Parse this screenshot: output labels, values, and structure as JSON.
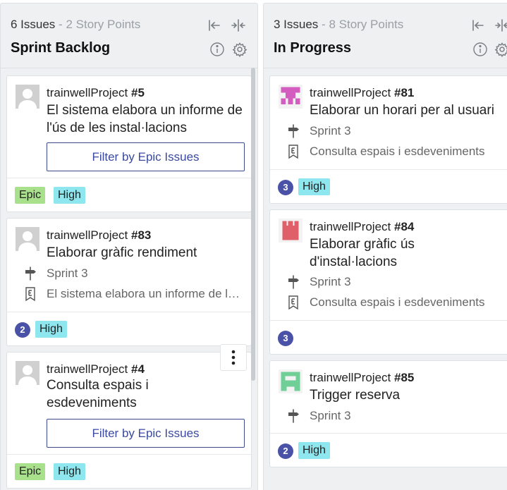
{
  "columns": [
    {
      "issues": "6 Issues",
      "separator": "-",
      "story_points": "2 Story Points",
      "title": "Sprint Backlog",
      "cards": [
        {
          "project": "trainwellProject",
          "number": "#5",
          "title": "El sistema elabora un informe de l'ús de les instal·lacions",
          "filter_label": "Filter by Epic Issues",
          "tags": [
            "Epic",
            "High"
          ],
          "avatar": "placeholder-avatar"
        },
        {
          "project": "trainwellProject",
          "number": "#83",
          "title": "Elaborar gràfic rendiment",
          "sprint": "Sprint 3",
          "epic": "El sistema elabora un informe de l'ús de les instal·lacions",
          "points": "2",
          "tags": [
            "High"
          ],
          "avatar": "placeholder-avatar"
        },
        {
          "project": "trainwellProject",
          "number": "#4",
          "title": "Consulta espais i esdeveniments",
          "filter_label": "Filter by Epic Issues",
          "tags": [
            "Epic",
            "High"
          ],
          "avatar": "placeholder-avatar"
        }
      ]
    },
    {
      "issues": "3 Issues",
      "separator": "-",
      "story_points": "8 Story Points",
      "title": "In Progress",
      "cards": [
        {
          "project": "trainwellProject",
          "number": "#81",
          "title": "Elaborar un horari per al usuari",
          "sprint": "Sprint 3",
          "epic": "Consulta espais i esdeveniments",
          "points": "3",
          "tags": [
            "High"
          ],
          "avatar": "identicon-pink"
        },
        {
          "project": "trainwellProject",
          "number": "#84",
          "title": "Elaborar gràfic ús d'instal·lacions",
          "sprint": "Sprint 3",
          "epic": "Consulta espais i esdeveniments",
          "points": "3",
          "tags": [],
          "avatar": "identicon-red"
        },
        {
          "project": "trainwellProject",
          "number": "#85",
          "title": "Trigger reserva",
          "sprint": "Sprint 3",
          "points": "2",
          "tags": [
            "High"
          ],
          "avatar": "identicon-green"
        }
      ]
    }
  ],
  "colors": {
    "epic_tag": "#a8e08c",
    "high_tag": "#8ee6ee",
    "points_badge": "#4a52a8",
    "filter_button_border": "#3b4a8f"
  },
  "icons": {
    "collapse": "collapse-left-icon",
    "compress": "compress-icon",
    "info": "info-icon",
    "settings": "gear-icon",
    "sprint": "signpost-icon",
    "epic": "epic-bookmark-icon",
    "menu": "kebab-menu-icon"
  }
}
